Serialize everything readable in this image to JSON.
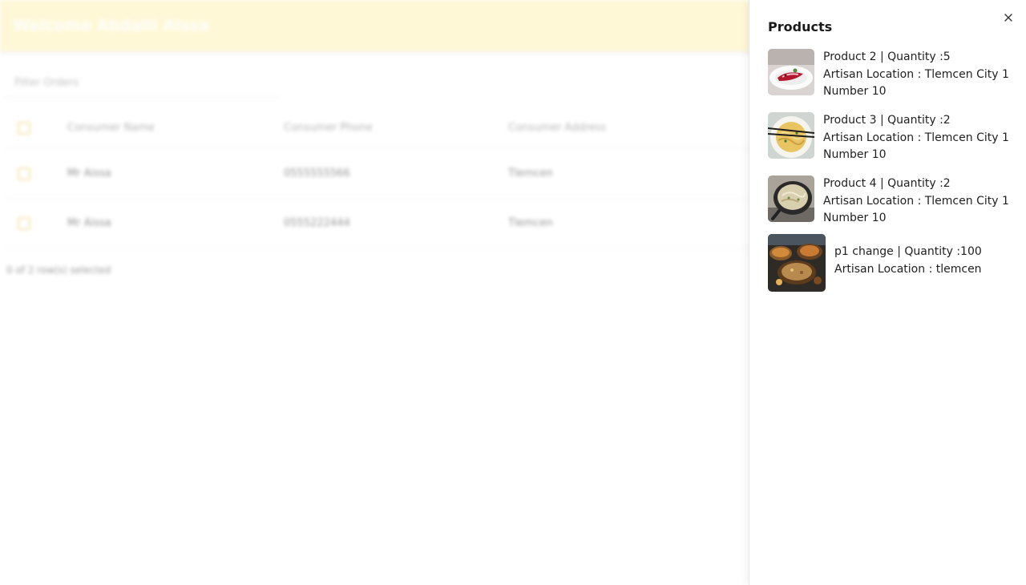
{
  "app": {
    "title": "Welcome Abdalli Aissa"
  },
  "orders": {
    "search_placeholder": "Filter Orders",
    "columns": [
      "Consumer Name",
      "Consumer Phone",
      "Consumer Address"
    ],
    "rows": [
      [
        "Mr Aissa",
        "0555555566",
        "Tlemcen"
      ],
      [
        "Mr Aissa",
        "0555222444",
        "Tlemcen"
      ]
    ],
    "footer": "0 of 2 row(s) selected"
  },
  "drawer": {
    "title": "Products",
    "close_icon": "close-icon",
    "items": [
      {
        "line1": "Product 2 | Quantity :5",
        "line2": "Artisan Location : Tlemcen City 1",
        "line3": "Number 10",
        "image": "dessert-plate"
      },
      {
        "line1": "Product 3 | Quantity :2",
        "line2": "Artisan Location : Tlemcen City 1",
        "line3": "Number 10",
        "image": "noodle-bowl"
      },
      {
        "line1": "Product 4 | Quantity :2",
        "line2": "Artisan Location : Tlemcen City 1",
        "line3": "Number 10",
        "image": "skillet-dish"
      },
      {
        "line1": "p1 change | Quantity :100",
        "line2": "Artisan Location : tlemcen",
        "image": "food-spread"
      }
    ]
  }
}
